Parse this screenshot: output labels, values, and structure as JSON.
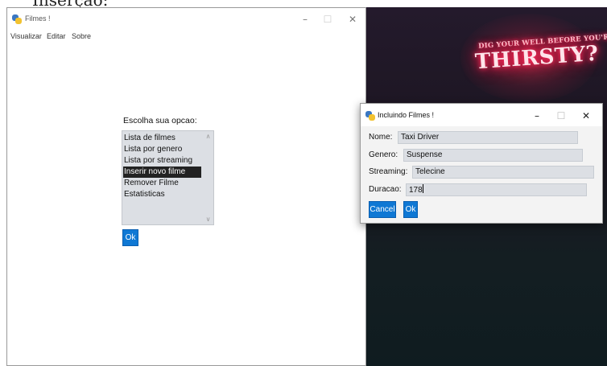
{
  "top_caption": "Inserção:",
  "desktop": {
    "neon_line1": "DIG YOUR WELL BEFORE YOU'RE",
    "neon_line2": "THIRSTY?"
  },
  "main_window": {
    "title": "Filmes !",
    "controls": {
      "minimize": "–",
      "maximize": "☐",
      "close": "✕"
    },
    "menu": [
      "Visualizar",
      "Editar",
      "Sobre"
    ],
    "prompt": "Escolha sua opcao:",
    "listbox": {
      "items": [
        "Lista de filmes",
        "Lista por genero",
        "Lista por streaming",
        "Inserir novo filme",
        "Remover Filme",
        "Estatisticas"
      ],
      "selected_index": 3
    },
    "ok_label": "Ok"
  },
  "dialog": {
    "title": "Incluindo Filmes !",
    "controls": {
      "minimize": "–",
      "maximize": "☐",
      "close": "✕"
    },
    "fields": [
      {
        "label": "Nome:",
        "value": "Taxi Driver"
      },
      {
        "label": "Genero:",
        "value": "Suspense"
      },
      {
        "label": "Streaming:",
        "value": "Telecine"
      },
      {
        "label": "Duracao:",
        "value": "178"
      }
    ],
    "cancel_label": "Cancel",
    "ok_label": "Ok"
  },
  "colors": {
    "accent": "#0f78d4",
    "selection_bg": "#222222",
    "field_bg": "#dcdfe4",
    "neon": "#ff3060"
  }
}
